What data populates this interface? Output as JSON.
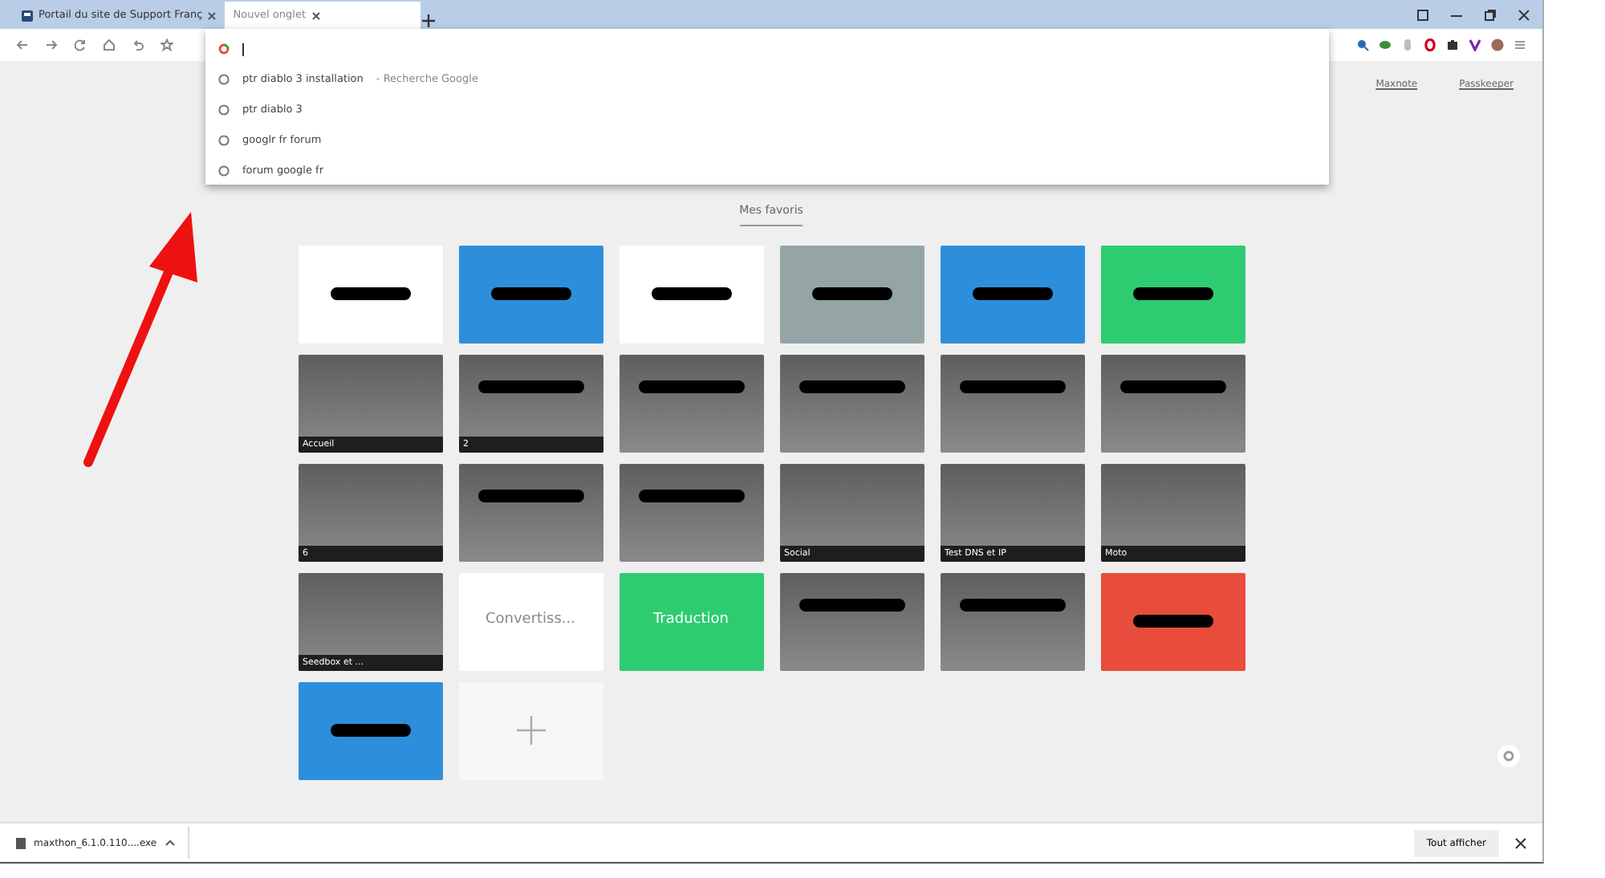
{
  "tabs": [
    {
      "title": "Portail du site de Support Franç",
      "selected": false
    },
    {
      "title": "Nouvel onglet",
      "selected": true
    }
  ],
  "omnibox": {
    "suggestions": [
      {
        "text": "ptr diablo 3 installation",
        "detail": "- Recherche Google"
      },
      {
        "text": "ptr diablo 3"
      },
      {
        "text": "googlr fr forum"
      },
      {
        "text": "forum google fr"
      }
    ]
  },
  "top_links": [
    "Maxnote",
    "Passkeeper"
  ],
  "favorites": {
    "heading": "Mes favoris",
    "tiles": [
      {
        "kind": "color",
        "color": "#ffffff",
        "redacted": true
      },
      {
        "kind": "color",
        "color": "#2d8fdc",
        "redacted": true
      },
      {
        "kind": "color",
        "color": "#ffffff",
        "redacted": true
      },
      {
        "kind": "color",
        "color": "#95a5a6",
        "redacted": true
      },
      {
        "kind": "color",
        "color": "#2d8fdc",
        "redacted": true
      },
      {
        "kind": "color",
        "color": "#2ecc71",
        "redacted": true
      },
      {
        "kind": "folder",
        "label": "Accueil",
        "redacted": false
      },
      {
        "kind": "folder",
        "label": "2",
        "redacted": true
      },
      {
        "kind": "folder",
        "redacted": true
      },
      {
        "kind": "folder",
        "redacted": true
      },
      {
        "kind": "folder",
        "redacted": true
      },
      {
        "kind": "folder",
        "redacted": true
      },
      {
        "kind": "folder",
        "label": "6",
        "redacted": false
      },
      {
        "kind": "folder",
        "redacted": true
      },
      {
        "kind": "folder",
        "redacted": true
      },
      {
        "kind": "folder",
        "label": "Social",
        "redacted": false
      },
      {
        "kind": "folder",
        "label": "Test DNS et IP",
        "redacted": false
      },
      {
        "kind": "folder",
        "label": "Moto",
        "redacted": false
      },
      {
        "kind": "folder",
        "label": "Seedbox et ...",
        "redacted": false
      },
      {
        "kind": "text",
        "color": "#ffffff",
        "label": "Convertiss..."
      },
      {
        "kind": "text",
        "color": "#2ecc71",
        "label": "Traduction"
      },
      {
        "kind": "folder",
        "redacted": true
      },
      {
        "kind": "folder",
        "redacted": true
      },
      {
        "kind": "color",
        "color": "#e74c3c",
        "redacted": true
      },
      {
        "kind": "color",
        "color": "#2d8fdc",
        "redacted": true
      },
      {
        "kind": "add"
      }
    ]
  },
  "downloads": {
    "file": "maxthon_6.1.0.110....exe",
    "show_all": "Tout afficher"
  }
}
